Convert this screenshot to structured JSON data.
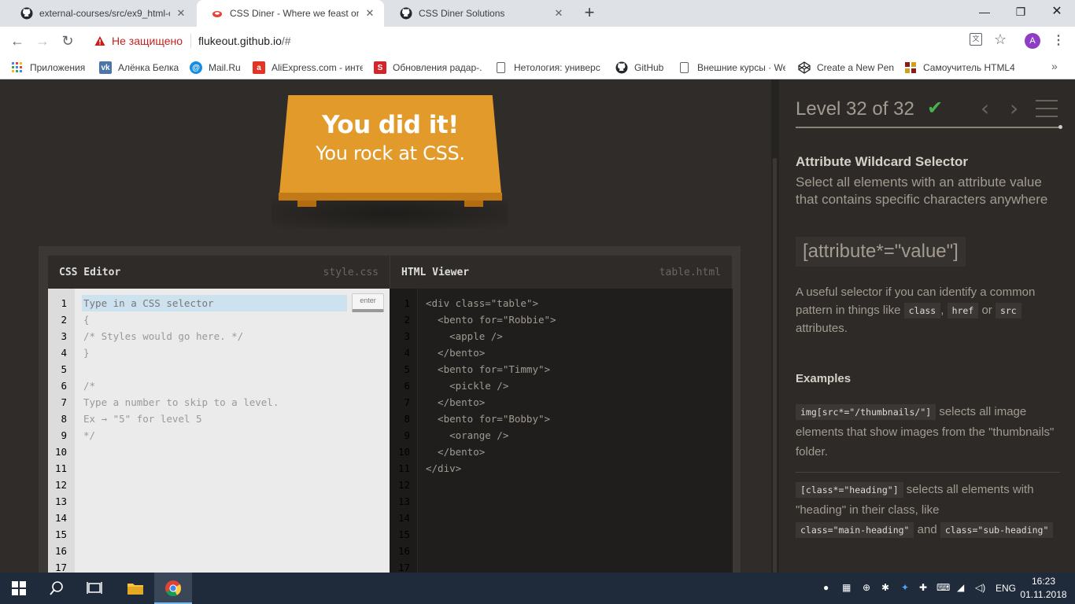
{
  "browser": {
    "tabs": [
      {
        "title": "external-courses/src/ex9_html-cs",
        "icon": "github-icon"
      },
      {
        "title": "CSS Diner - Where we feast on C",
        "icon": "css-diner-icon",
        "active": true
      },
      {
        "title": "CSS Diner Solutions",
        "icon": "github-icon"
      }
    ],
    "address": {
      "security": "Не защищено",
      "host": "flukeout.github.io",
      "path": "/#"
    },
    "avatar_letter": "A",
    "bookmarks": [
      {
        "label": "Приложения",
        "icon": "apps-grid-icon"
      },
      {
        "label": "Алёнка Белка",
        "icon": "vk-icon"
      },
      {
        "label": "Mail.Ru",
        "icon": "mailru-icon"
      },
      {
        "label": "AliExpress.com - инте",
        "icon": "aliexpress-icon"
      },
      {
        "label": "Обновления радар-.",
        "icon": "s-logo-icon"
      },
      {
        "label": "Нетология: универс",
        "icon": "document-icon"
      },
      {
        "label": "GitHub",
        "icon": "github-icon"
      },
      {
        "label": "Внешние курсы · We",
        "icon": "document-icon"
      },
      {
        "label": "Create a New Pen",
        "icon": "codepen-icon"
      },
      {
        "label": "Самоучитель HTML4",
        "icon": "tutorial-icon"
      }
    ]
  },
  "game": {
    "win_line1": "You did it!",
    "win_line2": "You rock at CSS.",
    "css_editor": {
      "title": "CSS Editor",
      "file": "style.css",
      "placeholder": "Type in a CSS selector",
      "enter_label": "enter",
      "lines": [
        "{",
        "/* Styles would go here. */",
        "}",
        "",
        "/*",
        "Type a number to skip to a level.",
        "Ex → \"5\" for level 5",
        "*/"
      ],
      "line_numbers": [
        "1",
        "2",
        "3",
        "4",
        "5",
        "6",
        "7",
        "8",
        "9",
        "10",
        "11",
        "12",
        "13",
        "14",
        "15",
        "16",
        "17"
      ]
    },
    "html_viewer": {
      "title": "HTML Viewer",
      "file": "table.html",
      "lines": [
        "<div class=\"table\">",
        "  <bento for=\"Robbie\">",
        "    <apple />",
        "  </bento>",
        "  <bento for=\"Timmy\">",
        "    <pickle />",
        "  </bento>",
        "  <bento for=\"Bobby\">",
        "    <orange />",
        "  </bento>",
        "</div>"
      ],
      "line_numbers": [
        "1",
        "2",
        "3",
        "4",
        "5",
        "6",
        "7",
        "8",
        "9",
        "10",
        "11",
        "12",
        "13",
        "14",
        "15",
        "16",
        "17"
      ]
    }
  },
  "sidebar": {
    "level_text": "Level 32 of 32",
    "level_progress": 1.0,
    "selector_name": "Attribute Wildcard Selector",
    "selector_title": "Select all elements with an attribute value that contains specific characters anywhere",
    "syntax": "[attribute*=\"value\"]",
    "hint_pre": "A useful selector if you can identify a common pattern in things like",
    "hint_tag1": "class",
    "hint_sep": ",",
    "hint_tag2": "href",
    "hint_or": "or",
    "hint_tag3": "src",
    "hint_post": "attributes.",
    "examples_heading": "Examples",
    "example1_code": "img[src*=\"/thumbnails/\"]",
    "example1_text": "selects all image elements that show images from the \"thumbnails\" folder.",
    "example2_code": "[class*=\"heading\"]",
    "example2_text1": "selects all elements with \"heading\" in their class, like",
    "example2_code2": "class=\"main-heading\"",
    "example2_and": "and",
    "example2_code3": "class=\"sub-heading\""
  },
  "taskbar": {
    "lang": "ENG",
    "time": "16:23",
    "date": "01.11.2018"
  }
}
